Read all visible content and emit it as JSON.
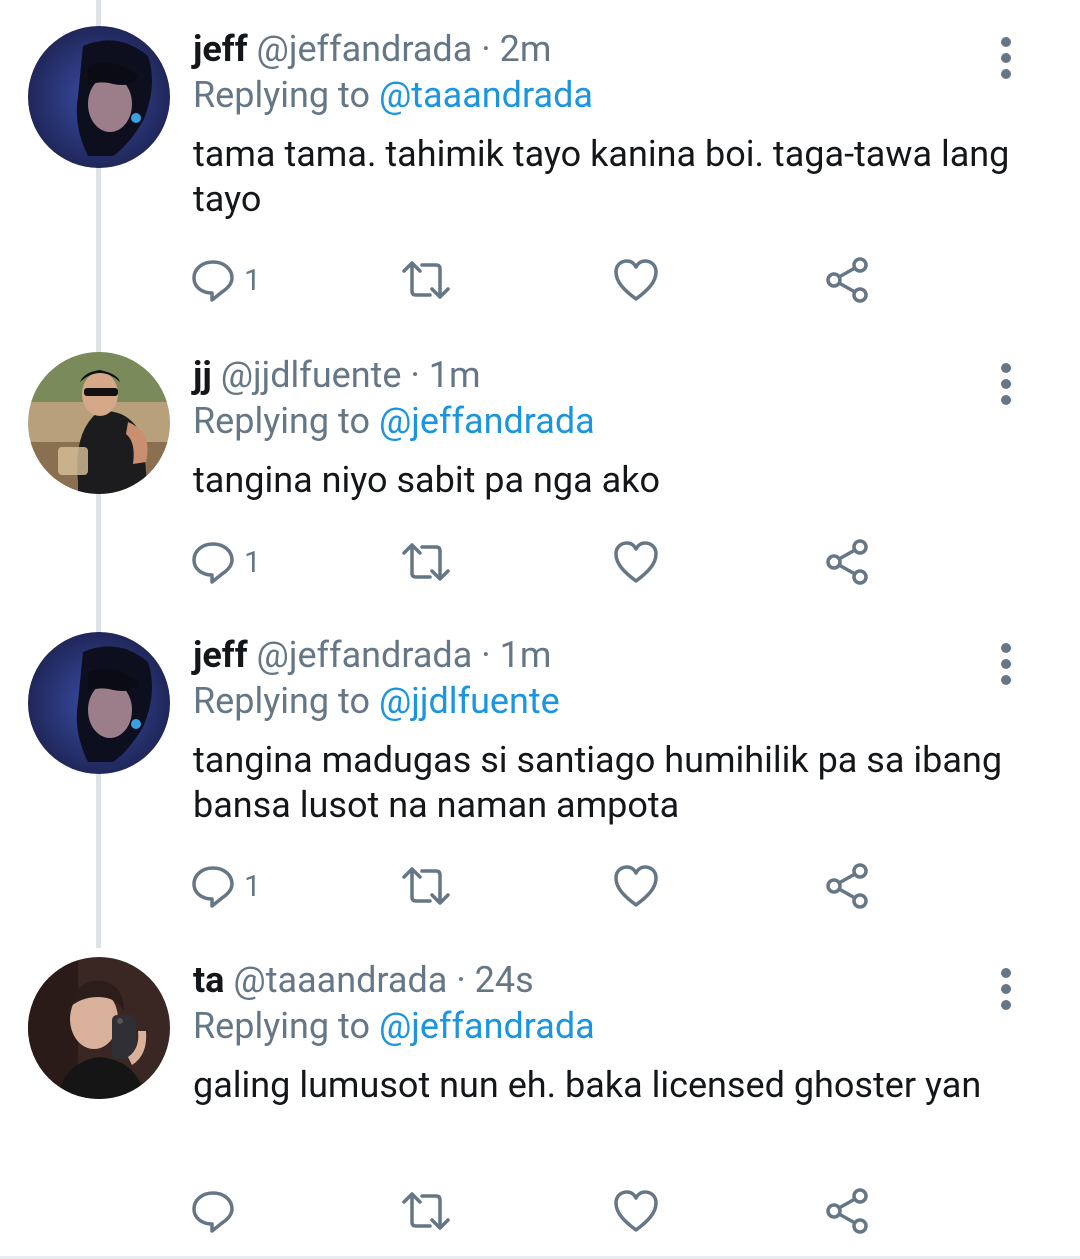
{
  "tweets": [
    {
      "name": "jeff",
      "handle": "@jeffandrada",
      "separator": "·",
      "time": "2m",
      "replying_label": "Replying to",
      "replying_to": "@taaandrada",
      "text": "tama tama. tahimik tayo kanina boi. taga-tawa lang tayo",
      "reply_count": "1",
      "avatar": "avatar-jeff"
    },
    {
      "name": "jj",
      "handle": "@jjdlfuente",
      "separator": "·",
      "time": "1m",
      "replying_label": "Replying to",
      "replying_to": "@jeffandrada",
      "text": "tangina niyo sabit pa nga ako",
      "reply_count": "1",
      "avatar": "avatar-jj"
    },
    {
      "name": "jeff",
      "handle": "@jeffandrada",
      "separator": "·",
      "time": "1m",
      "replying_label": "Replying to",
      "replying_to": "@jjdlfuente",
      "text": "tangina madugas si santiago humihilik pa sa ibang bansa lusot na naman ampota",
      "reply_count": "1",
      "avatar": "avatar-jeff"
    },
    {
      "name": "ta",
      "handle": "@taaandrada",
      "separator": "·",
      "time": "24s",
      "replying_label": "Replying to",
      "replying_to": "@jeffandrada",
      "text": "galing lumusot nun eh. baka licensed ghoster yan",
      "reply_count": "",
      "avatar": "avatar-ta"
    }
  ],
  "icons": {
    "reply": "reply-icon",
    "retweet": "retweet-icon",
    "like": "heart-icon",
    "share": "share-icon",
    "more": "more-vertical-icon"
  },
  "colors": {
    "text_primary": "#14171a",
    "text_secondary": "#657786",
    "link": "#1b95e0",
    "icon": "#657786",
    "thread_line": "#dfe3e7"
  }
}
